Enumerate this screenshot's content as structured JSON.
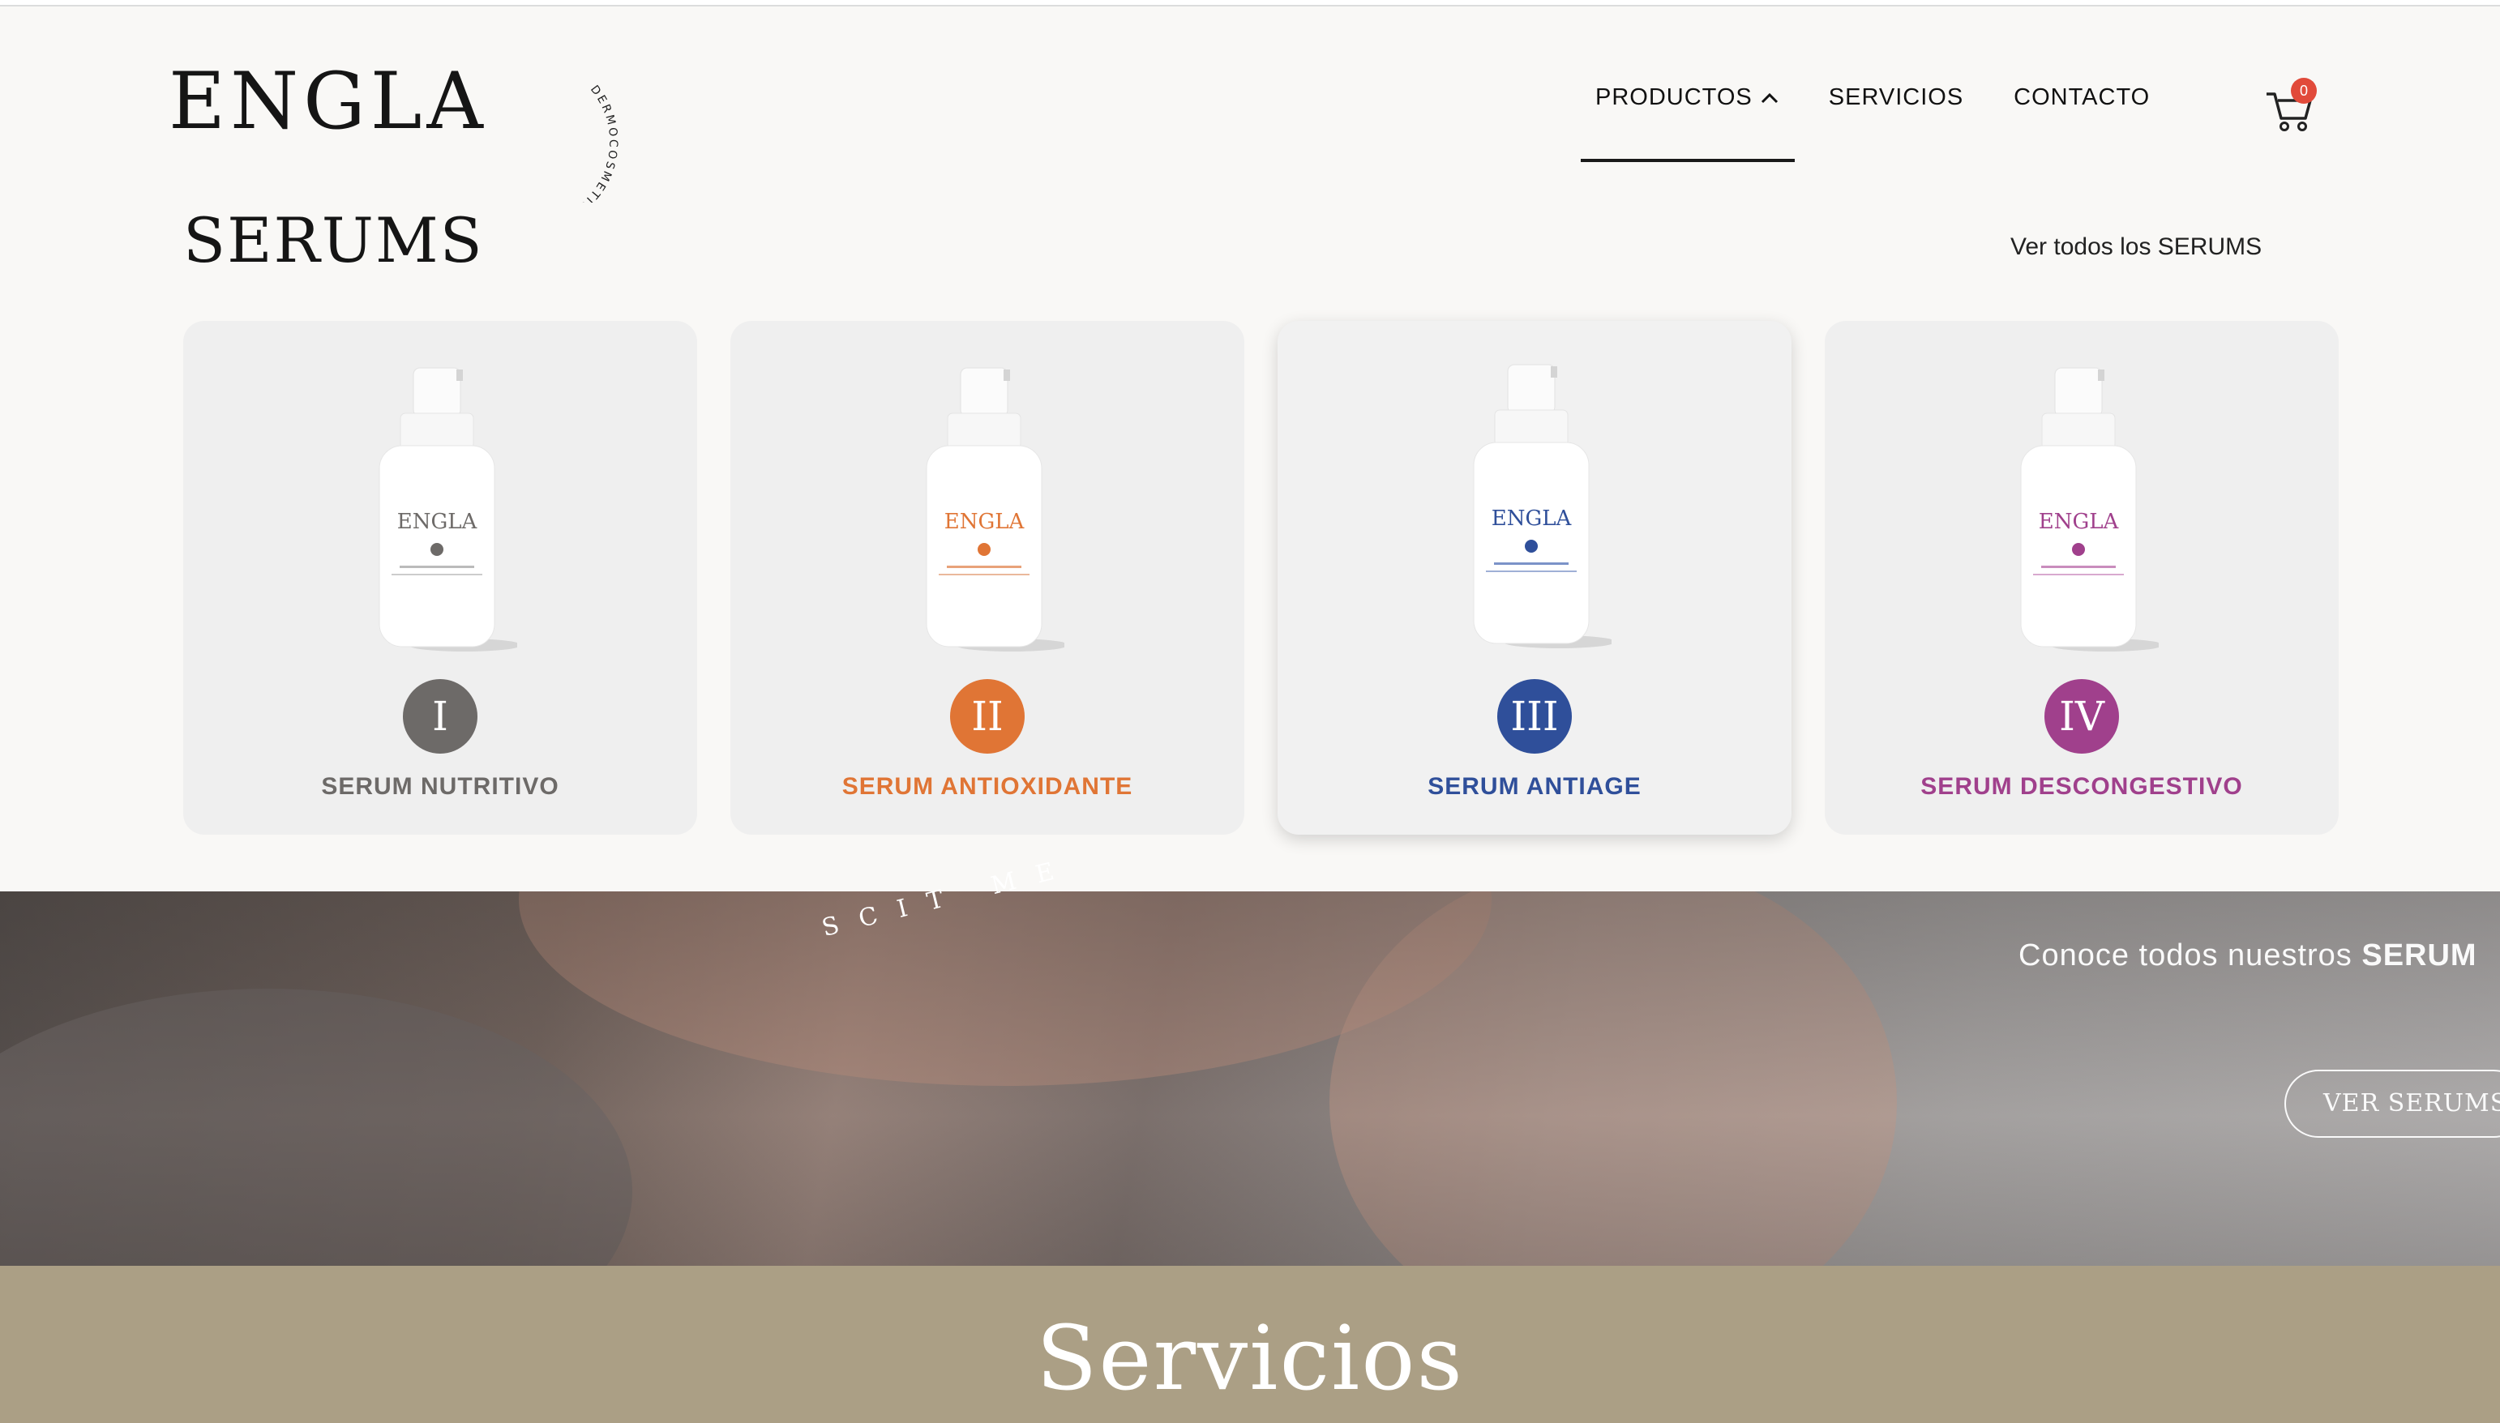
{
  "brand": {
    "name": "ENGLA",
    "tagline": "DERMOCOSMETICS"
  },
  "nav": {
    "items": [
      {
        "label": "PRODUCTOS"
      },
      {
        "label": "SERVICIOS"
      },
      {
        "label": "CONTACTO"
      }
    ],
    "cart_count": "0"
  },
  "serums": {
    "title": "SERUMS",
    "see_all": "Ver todos los SERUMS",
    "products": [
      {
        "numeral": "I",
        "name": "SERUM NUTRITIVO",
        "color": "#6d6a68",
        "label_line": "SERUM NUTRITIVO"
      },
      {
        "numeral": "II",
        "name": "SERUM ANTIOXIDANTE",
        "color": "#e07535",
        "label_line": "SERUM ANTIOXIDANTE"
      },
      {
        "numeral": "III",
        "name": "SERUM ANTIAGE",
        "color": "#2f4f9a",
        "label_line": "SERUM ANTIAGE"
      },
      {
        "numeral": "IV",
        "name": "SERUM DESCONGESTIVO",
        "color": "#a0408c",
        "label_line": "SERUM DESCONGESTIVO"
      }
    ]
  },
  "banner": {
    "text_prefix": "Conoce todos nuestros ",
    "text_bold": "SERUM",
    "button": "VER SERUMS",
    "arc_text": "SCIT ME"
  },
  "services": {
    "title": "Servicios"
  }
}
